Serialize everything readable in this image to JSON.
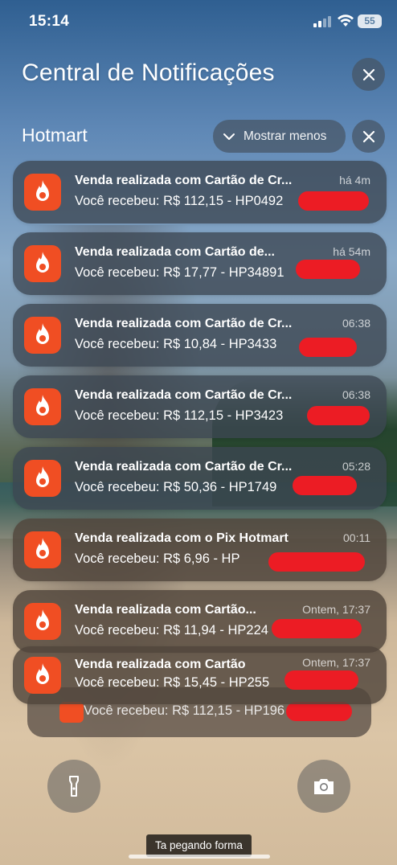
{
  "status_bar": {
    "time": "15:14",
    "battery": "55"
  },
  "notification_center": {
    "title": "Central de Notificações"
  },
  "group": {
    "app_name": "Hotmart",
    "collapse_label": "Mostrar menos"
  },
  "notifications": [
    {
      "title": "Venda realizada com Cartão de Cr...",
      "body": "Você recebeu: R$ 112,15 - HP0492",
      "time": "há 4m"
    },
    {
      "title": "Venda realizada com Cartão de...",
      "body": "Você recebeu: R$ 17,77 - HP34891",
      "time": "há 54m"
    },
    {
      "title": "Venda realizada com Cartão de Cr...",
      "body": "Você recebeu: R$ 10,84 - HP3433",
      "time": "06:38"
    },
    {
      "title": "Venda realizada com Cartão de Cr...",
      "body": "Você recebeu: R$ 112,15 - HP3423",
      "time": "06:38"
    },
    {
      "title": "Venda realizada com Cartão de Cr...",
      "body": "Você recebeu: R$ 50,36 - HP1749",
      "time": "05:28"
    },
    {
      "title": "Venda realizada com o Pix Hotmart",
      "body": "Você recebeu: R$ 6,96 - HP",
      "time": "00:11"
    },
    {
      "title": "Venda realizada com Cartão...",
      "body": "Você recebeu: R$ 11,94 - HP224",
      "time": "Ontem, 17:37"
    },
    {
      "title": "Venda realizada com Cartão",
      "body": "Você recebeu: R$ 15,45 - HP255",
      "time": "Ontem, 17:37"
    }
  ],
  "stacked_notification": {
    "body": "Você recebeu: R$ 112,15 - HP196"
  },
  "quick_actions": {
    "flashlight_icon": "flashlight-icon",
    "camera_icon": "camera-icon"
  },
  "caption": "Ta pegando forma",
  "colors": {
    "hotmart_orange": "#f04e23",
    "redaction_red": "#ec1c24"
  }
}
